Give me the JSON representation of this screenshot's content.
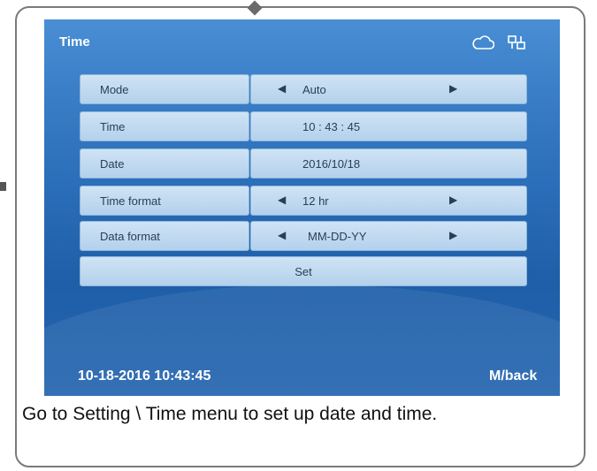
{
  "screen": {
    "title": "Time",
    "icons": [
      "cloud-icon",
      "lan-icon"
    ]
  },
  "rows": [
    {
      "label": "Mode",
      "value": "Auto",
      "has_arrows": true
    },
    {
      "label": "Time",
      "value": "10 : 43 : 45",
      "has_arrows": false
    },
    {
      "label": "Date",
      "value": "2016/10/18",
      "has_arrows": false
    },
    {
      "label": "Time format",
      "value": "12 hr",
      "has_arrows": true
    },
    {
      "label": "Data format",
      "value": "MM-DD-YY",
      "has_arrows": true
    }
  ],
  "set_label": "Set",
  "arrows": {
    "left": "◀",
    "right": "▶"
  },
  "status": {
    "datetime": "10-18-2016 10:43:45",
    "back_label": "M/back"
  },
  "caption": "Go to Setting \\ Time menu to set up date and time.",
  "colors": {
    "screen_top": "#4a8fd4",
    "screen_bottom": "#1f5ea8",
    "cell_fill": "#cfe3f4",
    "text_dark": "#2a3e58"
  }
}
